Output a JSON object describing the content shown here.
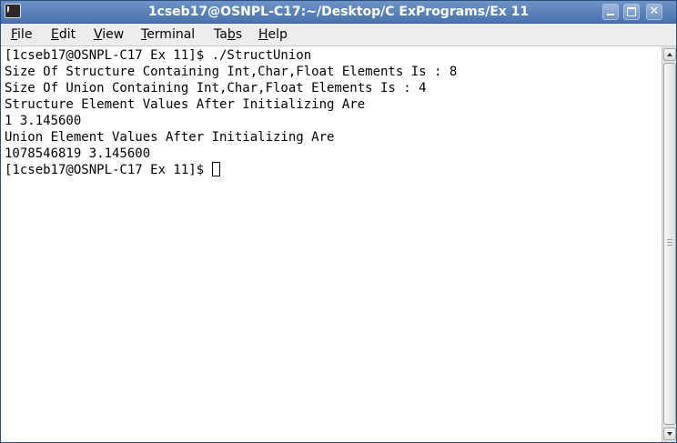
{
  "window": {
    "title": "1cseb17@OSNPL-C17:~/Desktop/C ExPrograms/Ex 11",
    "minimize_glyph": "",
    "maximize_glyph": "",
    "close_glyph": "✕",
    "icon": "terminal-icon"
  },
  "menu": {
    "file": {
      "mnemonic": "F",
      "rest": "ile"
    },
    "edit": {
      "mnemonic": "E",
      "rest": "dit"
    },
    "view": {
      "mnemonic": "V",
      "rest": "iew"
    },
    "terminal": {
      "mnemonic": "T",
      "rest": "erminal"
    },
    "tabs": {
      "pre": "Ta",
      "mnemonic": "b",
      "rest": "s"
    },
    "help": {
      "mnemonic": "H",
      "rest": "elp"
    }
  },
  "terminal": {
    "lines": [
      "[1cseb17@OSNPL-C17 Ex 11]$ ./StructUnion",
      "Size Of Structure Containing Int,Char,Float Elements Is : 8",
      "Size Of Union Containing Int,Char,Float Elements Is : 4",
      "Structure Element Values After Initializing Are",
      "1 3.145600",
      "Union Element Values After Initializing Are",
      "1078546819 3.145600"
    ],
    "prompt": "[1cseb17@OSNPL-C17 Ex 11]$ "
  },
  "colors": {
    "titlebar": "#4a73ad",
    "terminal_bg": "#ffffff",
    "terminal_fg": "#000000"
  }
}
